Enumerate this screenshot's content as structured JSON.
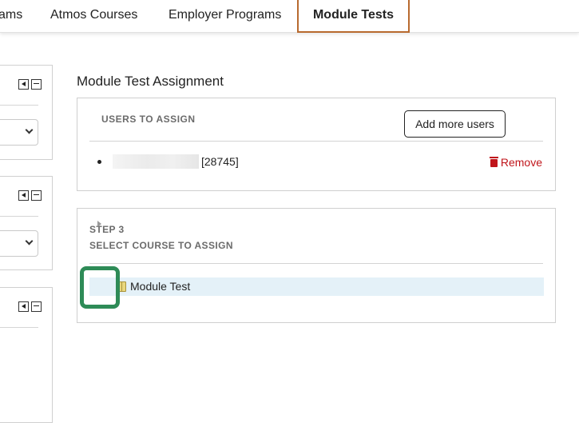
{
  "nav": {
    "tabs": [
      {
        "label": "ams"
      },
      {
        "label": "Atmos Courses"
      },
      {
        "label": "Employer Programs"
      },
      {
        "label": "Module Tests",
        "active": true
      }
    ]
  },
  "left_panels": [
    {
      "collapse_icon": "arrow-left-icon",
      "minimize_icon": "minus-icon"
    },
    {
      "collapse_icon": "arrow-left-icon",
      "minimize_icon": "minus-icon"
    },
    {
      "collapse_icon": "arrow-left-icon",
      "minimize_icon": "minus-icon"
    }
  ],
  "main": {
    "title": "Module Test Assignment",
    "users_card": {
      "header": "USERS TO ASSIGN",
      "add_button": "Add more users",
      "users": [
        {
          "id": "[28745]",
          "remove_label": "Remove"
        }
      ]
    },
    "course_card": {
      "step": "STEP 3",
      "label": "SELECT COURSE TO ASSIGN",
      "courses": [
        {
          "name": "Module Test",
          "icon": "book-icon"
        }
      ]
    }
  },
  "colors": {
    "active_tab_border": "#b86a2f",
    "remove": "#c0151b",
    "selected_row": "#e4f1f8",
    "highlight": "#2e8b57"
  }
}
